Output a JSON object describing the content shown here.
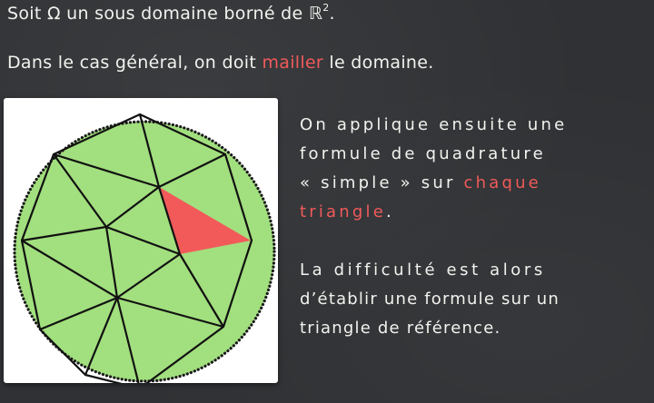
{
  "line1": {
    "prefix": "Soit Ω un sous domaine borné de ",
    "set": "ℝ",
    "exponent": "2",
    "suffix": "."
  },
  "line2": {
    "before": "Dans le cas général, on doit ",
    "highlight": "mailler",
    "after": " le domaine."
  },
  "para1": {
    "line1": "On applique ensuite une",
    "line2": "formule de quadrature",
    "line3_before": "« simple » sur ",
    "line3_highlight": "chaque",
    "line4_highlight": "triangle",
    "line4_after": "."
  },
  "para2": {
    "line1": "La difficulté est alors",
    "line2": "d’établir une formule sur un",
    "line3": "triangle de référence."
  },
  "colors": {
    "background": "#2f3134",
    "text": "#f2f2ee",
    "highlight": "#f05a5a",
    "domain_fill": "#a2df7e",
    "highlighted_triangle": "#f25a5a"
  }
}
